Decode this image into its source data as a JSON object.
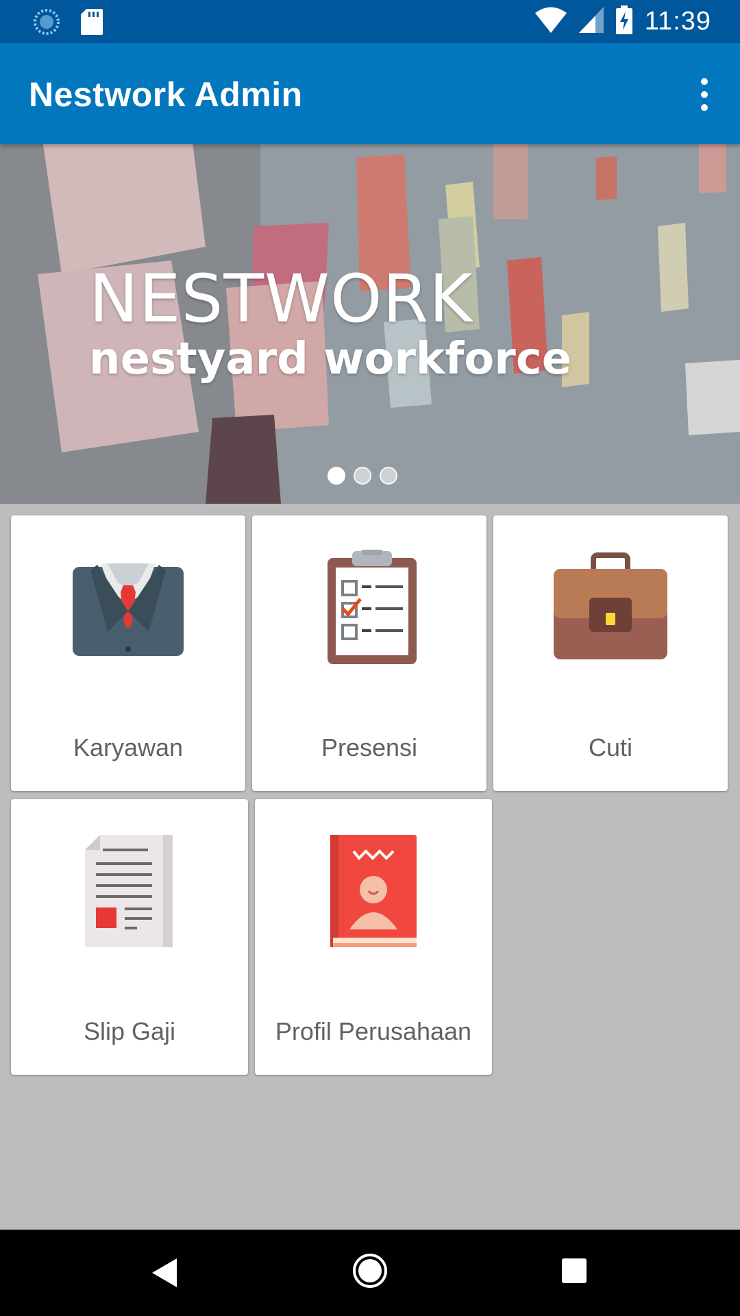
{
  "status_bar": {
    "time": "11:39",
    "left_icons": [
      "sync-icon",
      "sd-card-icon"
    ],
    "right_icons": [
      "wifi-icon",
      "signal-icon",
      "battery-charging-icon"
    ]
  },
  "app_bar": {
    "title": "Nestwork Admin",
    "menu_icon": "more-vert-icon"
  },
  "banner": {
    "title": "NESTWORK",
    "subtitle": "nestyard workforce",
    "slide_count": 3,
    "active_slide": 1
  },
  "menu": {
    "items": [
      {
        "label": "Karyawan",
        "icon": "suit-icon"
      },
      {
        "label": "Presensi",
        "icon": "clipboard-checklist-icon"
      },
      {
        "label": "Cuti",
        "icon": "briefcase-icon"
      },
      {
        "label": "Slip Gaji",
        "icon": "document-icon"
      },
      {
        "label": "Profil Perusahaan",
        "icon": "profile-book-icon"
      }
    ]
  },
  "nav_bar": {
    "icons": [
      "back-icon",
      "home-icon",
      "recents-icon"
    ]
  },
  "colors": {
    "status_bar": "#01579b",
    "app_bar": "#0277bd",
    "background": "#bdbdbd"
  }
}
